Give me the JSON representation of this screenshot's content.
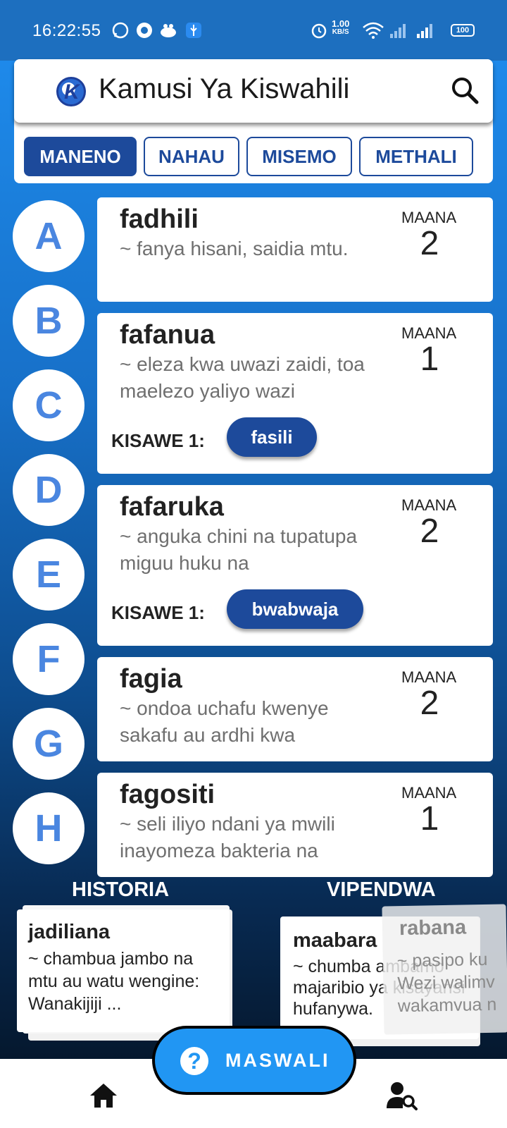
{
  "status_bar": {
    "time": "16:22:55",
    "speed_value": "1.00",
    "speed_unit": "KB/S",
    "battery": "100"
  },
  "app": {
    "title": "Kamusi Ya Kiswahili",
    "logo_letter": "K",
    "search_icon": "search-icon"
  },
  "tabs": [
    {
      "label": "MANENO",
      "active": true
    },
    {
      "label": "NAHAU",
      "active": false
    },
    {
      "label": "MISEMO",
      "active": false
    },
    {
      "label": "METHALI",
      "active": false
    }
  ],
  "alphabet": [
    "A",
    "B",
    "C",
    "D",
    "E",
    "F",
    "G",
    "H"
  ],
  "words": [
    {
      "word": "fadhili",
      "definition": "~ fanya hisani, saidia mtu.",
      "maana_label": "MAANA",
      "maana_count": "2"
    },
    {
      "word": "fafanua",
      "definition": "~ eleza kwa uwazi zaidi, toa maelezo yaliyo wazi",
      "maana_label": "MAANA",
      "maana_count": "1",
      "kisawe_label": "KISAWE 1:",
      "kisawe": "fasili"
    },
    {
      "word": "fafaruka",
      "definition": "~ anguka chini na tupatupa miguu huku na",
      "maana_label": "MAANA",
      "maana_count": "2",
      "kisawe_label": "KISAWE 1:",
      "kisawe": "bwabwaja"
    },
    {
      "word": "fagia",
      "definition": "~ ondoa uchafu kwenye sakafu au ardhi kwa",
      "maana_label": "MAANA",
      "maana_count": "2"
    },
    {
      "word": "fagositi",
      "definition": "~ seli iliyo ndani ya mwili inayomeza bakteria na",
      "maana_label": "MAANA",
      "maana_count": "1"
    }
  ],
  "historia": {
    "title": "HISTORIA",
    "word": "jadiliana",
    "definition": "~ chambua jambo na mtu au watu wengine: Wanakijiji ..."
  },
  "vipendwa": {
    "title": "VIPENDWA",
    "front": {
      "word": "maabara",
      "definition": "~ chumba ambamo majaribio ya kisayansi hufanywa."
    },
    "ghost_card": {
      "word": "rabana",
      "definition": "~ pasipo ku Wezi walimv wakamvua n"
    }
  },
  "fab": {
    "label": "MASWALI",
    "icon": "help-icon"
  },
  "bottom_nav": {
    "items": [
      "home-icon",
      "person-search-icon"
    ]
  },
  "colors": {
    "primary": "#1d4a9b",
    "accent": "#2196f3",
    "letter": "#4a86e0"
  }
}
